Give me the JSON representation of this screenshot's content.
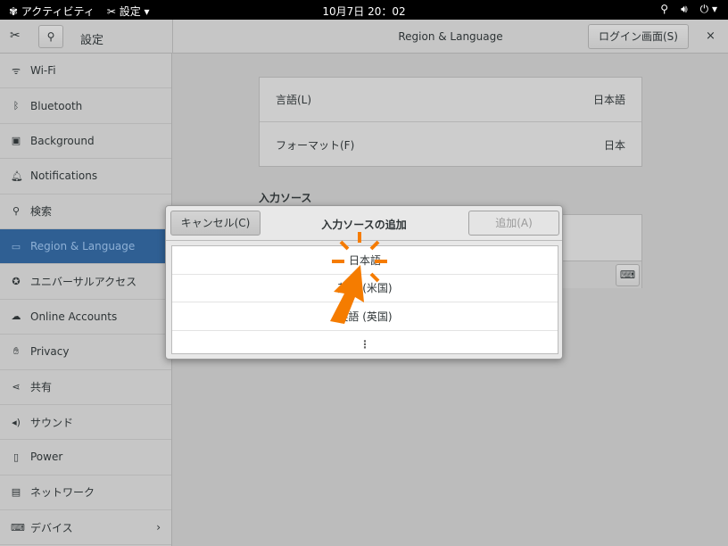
{
  "topbar": {
    "activities": "アクティビティ",
    "app_menu": "設定",
    "clock": "10月7日 20：02"
  },
  "header": {
    "app_title": "設定",
    "page_title": "Region & Language",
    "login_screen_button": "ログイン画面(S)",
    "close": "×"
  },
  "sidebar": {
    "items": [
      {
        "label": "Wi-Fi",
        "icon": "wifi-icon"
      },
      {
        "label": "Bluetooth",
        "icon": "bluetooth-icon"
      },
      {
        "label": "Background",
        "icon": "background-icon"
      },
      {
        "label": "Notifications",
        "icon": "bell-icon"
      },
      {
        "label": "検索",
        "icon": "search-icon"
      },
      {
        "label": "Region & Language",
        "icon": "region-icon",
        "selected": true
      },
      {
        "label": "ユニバーサルアクセス",
        "icon": "accessibility-icon"
      },
      {
        "label": "Online Accounts",
        "icon": "online-accounts-icon"
      },
      {
        "label": "Privacy",
        "icon": "hand-icon"
      },
      {
        "label": "共有",
        "icon": "share-icon"
      },
      {
        "label": "サウンド",
        "icon": "speaker-icon"
      },
      {
        "label": "Power",
        "icon": "power-icon"
      },
      {
        "label": "ネットワーク",
        "icon": "network-icon"
      },
      {
        "label": "デバイス",
        "icon": "devices-icon"
      }
    ]
  },
  "main": {
    "language_label": "言語(L)",
    "language_value": "日本語",
    "formats_label": "フォーマット(F)",
    "formats_value": "日本",
    "input_sources_heading": "入力ソース"
  },
  "dialog": {
    "title": "入力ソースの追加",
    "cancel": "キャンセル(C)",
    "add": "追加(A)",
    "items": [
      "日本語",
      "英語 (米国)",
      "英語 (英国)"
    ],
    "more": "⋮"
  },
  "colors": {
    "accent": "#2f5f93",
    "annotation": "#f57c00"
  }
}
